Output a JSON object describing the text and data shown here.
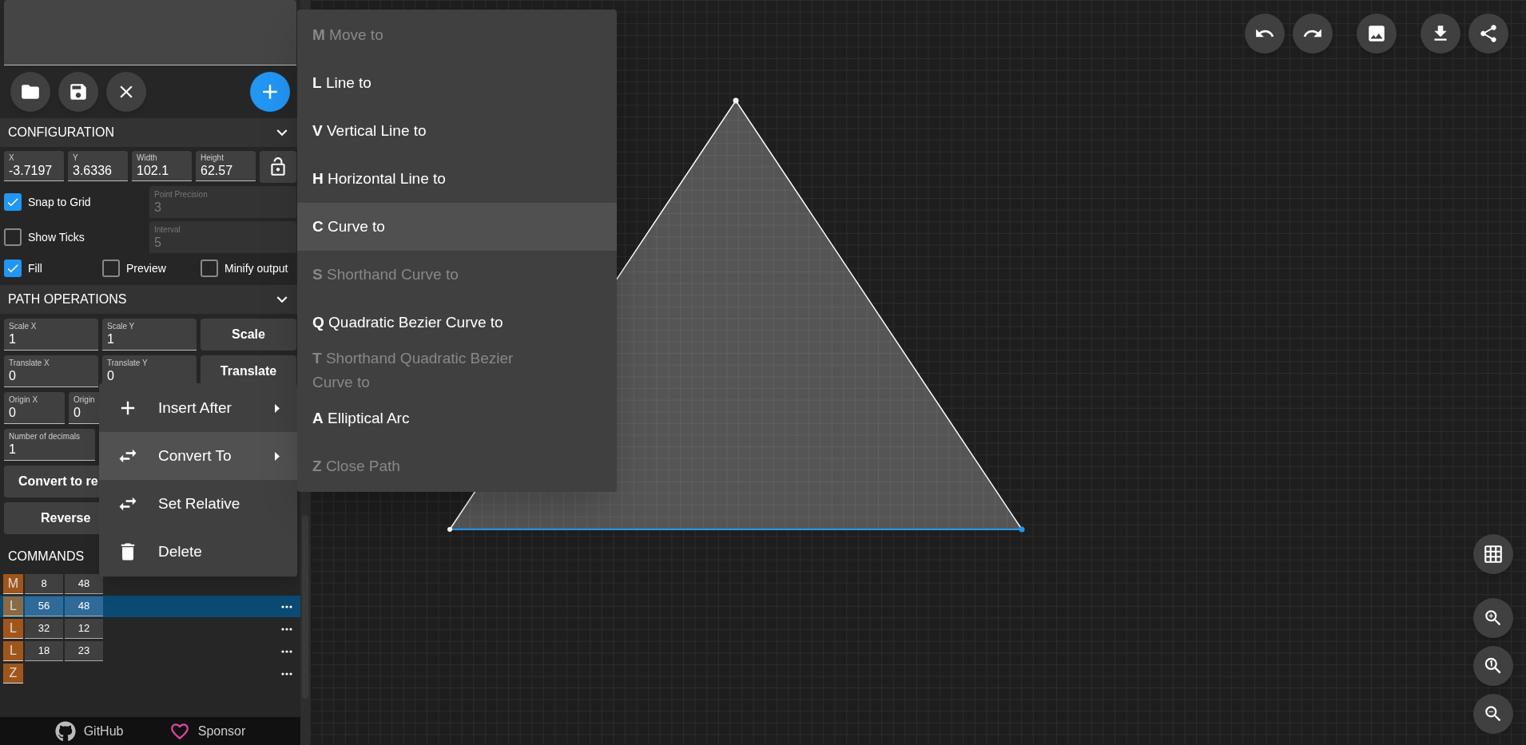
{
  "toolbar": {
    "buttons": [
      {
        "kind": "folder"
      },
      {
        "kind": "save"
      },
      {
        "kind": "close"
      }
    ],
    "add_button": {
      "kind": "add"
    }
  },
  "configuration": {
    "title": "CONFIGURATION",
    "expanded": true,
    "fields": [
      {
        "label": "X",
        "value": "-3.7197"
      },
      {
        "label": "Y",
        "value": "3.6336"
      },
      {
        "label": "Width",
        "value": "102.1"
      },
      {
        "label": "Height",
        "value": "62.57"
      }
    ],
    "locked": false,
    "snap_to_grid": {
      "label": "Snap to Grid",
      "checked": true
    },
    "point_precision": {
      "label": "Point Precision",
      "value": "3",
      "disabled": true
    },
    "show_ticks": {
      "label": "Show Ticks",
      "checked": false
    },
    "interval": {
      "label": "Interval",
      "value": "5",
      "disabled": true
    },
    "options": [
      {
        "label": "Fill",
        "checked": true
      },
      {
        "label": "Preview",
        "checked": false
      },
      {
        "label": "Minify output",
        "checked": false
      }
    ]
  },
  "path_operations": {
    "title": "PATH OPERATIONS",
    "expanded": true,
    "scale_fields": [
      {
        "label": "Scale X",
        "value": "1"
      },
      {
        "label": "Scale Y",
        "value": "1"
      }
    ],
    "scale_button": "Scale",
    "translate_fields": [
      {
        "label": "Translate X",
        "value": "0"
      },
      {
        "label": "Translate Y",
        "value": "0"
      }
    ],
    "translate_button": "Translate",
    "origin_fields": [
      {
        "label": "Origin X",
        "value": "0"
      },
      {
        "label": "Origin",
        "value": "0"
      }
    ],
    "decimals_field": {
      "label": "Number of decimals",
      "value": "1"
    },
    "convert_button": "Convert to re",
    "reverse_button": "Reverse"
  },
  "commands": {
    "title": "COMMANDS",
    "rows": [
      {
        "letter": "M",
        "values": [
          "8",
          "48"
        ],
        "selected": false,
        "more_button": false
      },
      {
        "letter": "L",
        "values": [
          "56",
          "48"
        ],
        "selected": true,
        "more_button": true
      },
      {
        "letter": "L",
        "values": [
          "32",
          "12"
        ],
        "selected": false,
        "more_button": true
      },
      {
        "letter": "L",
        "values": [
          "18",
          "23"
        ],
        "selected": false,
        "more_button": true
      },
      {
        "letter": "Z",
        "values": [],
        "selected": false,
        "more_button": true
      }
    ]
  },
  "footer": [
    {
      "kind": "github",
      "label": "GitHub"
    },
    {
      "kind": "heart",
      "label": "Sponsor"
    }
  ],
  "context_menu": [
    {
      "kind": "plus",
      "label": "Insert After",
      "submenu": true,
      "selected": false
    },
    {
      "kind": "swap",
      "label": "Convert To",
      "submenu": true,
      "selected": true
    },
    {
      "kind": "swap",
      "label": "Set Relative",
      "submenu": false,
      "selected": false
    },
    {
      "kind": "trash",
      "label": "Delete",
      "submenu": false,
      "selected": false
    }
  ],
  "convert_menu": [
    {
      "label": "**M** Move to",
      "disabled": true,
      "selected": false
    },
    {
      "label": "**L** Line to",
      "disabled": false,
      "selected": false
    },
    {
      "label": "**V** Vertical Line to",
      "disabled": false,
      "selected": false
    },
    {
      "label": "**H** Horizontal Line to",
      "disabled": false,
      "selected": false
    },
    {
      "label": "**C** Curve to",
      "disabled": false,
      "selected": true
    },
    {
      "label": "**S** Shorthand Curve to",
      "disabled": true,
      "selected": false
    },
    {
      "label": "**Q** Quadratic Bezier Curve to",
      "disabled": false,
      "selected": false
    },
    {
      "label": "**T** Shorthand Quadratic Bezier Curve to",
      "disabled": true,
      "selected": false
    },
    {
      "label": "**A** Elliptical Arc",
      "disabled": false,
      "selected": false
    },
    {
      "label": "**Z** Close Path",
      "disabled": true,
      "selected": false
    }
  ],
  "canvas_top_buttons": [
    {
      "kind": "undo"
    },
    {
      "kind": "redo"
    },
    {
      "kind": "image"
    },
    {
      "kind": "download"
    },
    {
      "kind": "share"
    }
  ],
  "canvas_side_buttons": [
    {
      "kind": "grid"
    },
    {
      "kind": "zoom-in"
    },
    {
      "kind": "zoom-reset"
    },
    {
      "kind": "zoom-out"
    }
  ]
}
